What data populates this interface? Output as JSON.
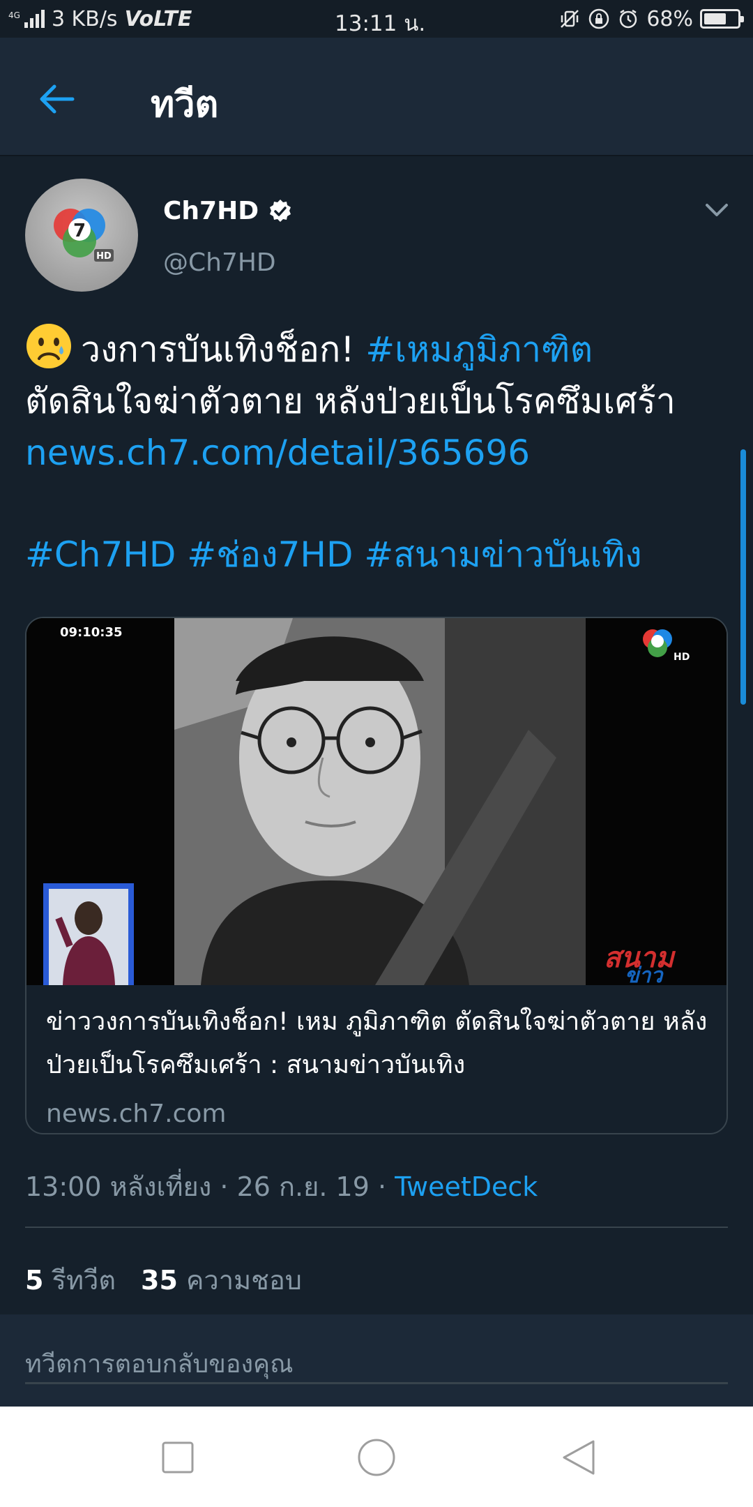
{
  "status_bar": {
    "network_tag": "4G",
    "speed": "3 KB/s",
    "volte": "VoLTE",
    "time": "13:11 น.",
    "battery": "68%"
  },
  "header": {
    "title": "ทวีต",
    "back_icon": "arrow-left-icon"
  },
  "tweet": {
    "author_name": "Ch7HD",
    "author_handle": "@Ch7HD",
    "text_part1": "วงการบันเทิงช็อก! ",
    "hashtag1": "#เหมภูมิภาฑิต",
    "text_part2": "ตัดสินใจฆ่าตัวตาย หลังป่วยเป็นโรคซึมเศร้า ",
    "link": "news.ch7.com/detail/365696",
    "hashtags_line": "#Ch7HD #ช่อง7HD #สนามข่าวบันเทิง",
    "card": {
      "timestamp_overlay": "09:10:35",
      "title": "ข่าววงการบันเทิงช็อก! เหม ภูมิภาฑิต ตัดสินใจฆ่าตัวตาย หลังป่วยเป็นโรคซึมเศร้า : สนามข่าวบันเทิง",
      "domain": "news.ch7.com"
    },
    "meta_time": "13:00 หลังเที่ยง · 26 ก.ย. 19 · ",
    "meta_source": "TweetDeck",
    "retweets_count": "5",
    "retweets_label": "รีทวีต",
    "likes_count": "35",
    "likes_label": "ความชอบ"
  },
  "reply": {
    "placeholder": "ทวีตการตอบกลับของคุณ"
  },
  "colors": {
    "background": "#15202b",
    "accent": "#1da1f2",
    "secondary_text": "#8899a6"
  }
}
